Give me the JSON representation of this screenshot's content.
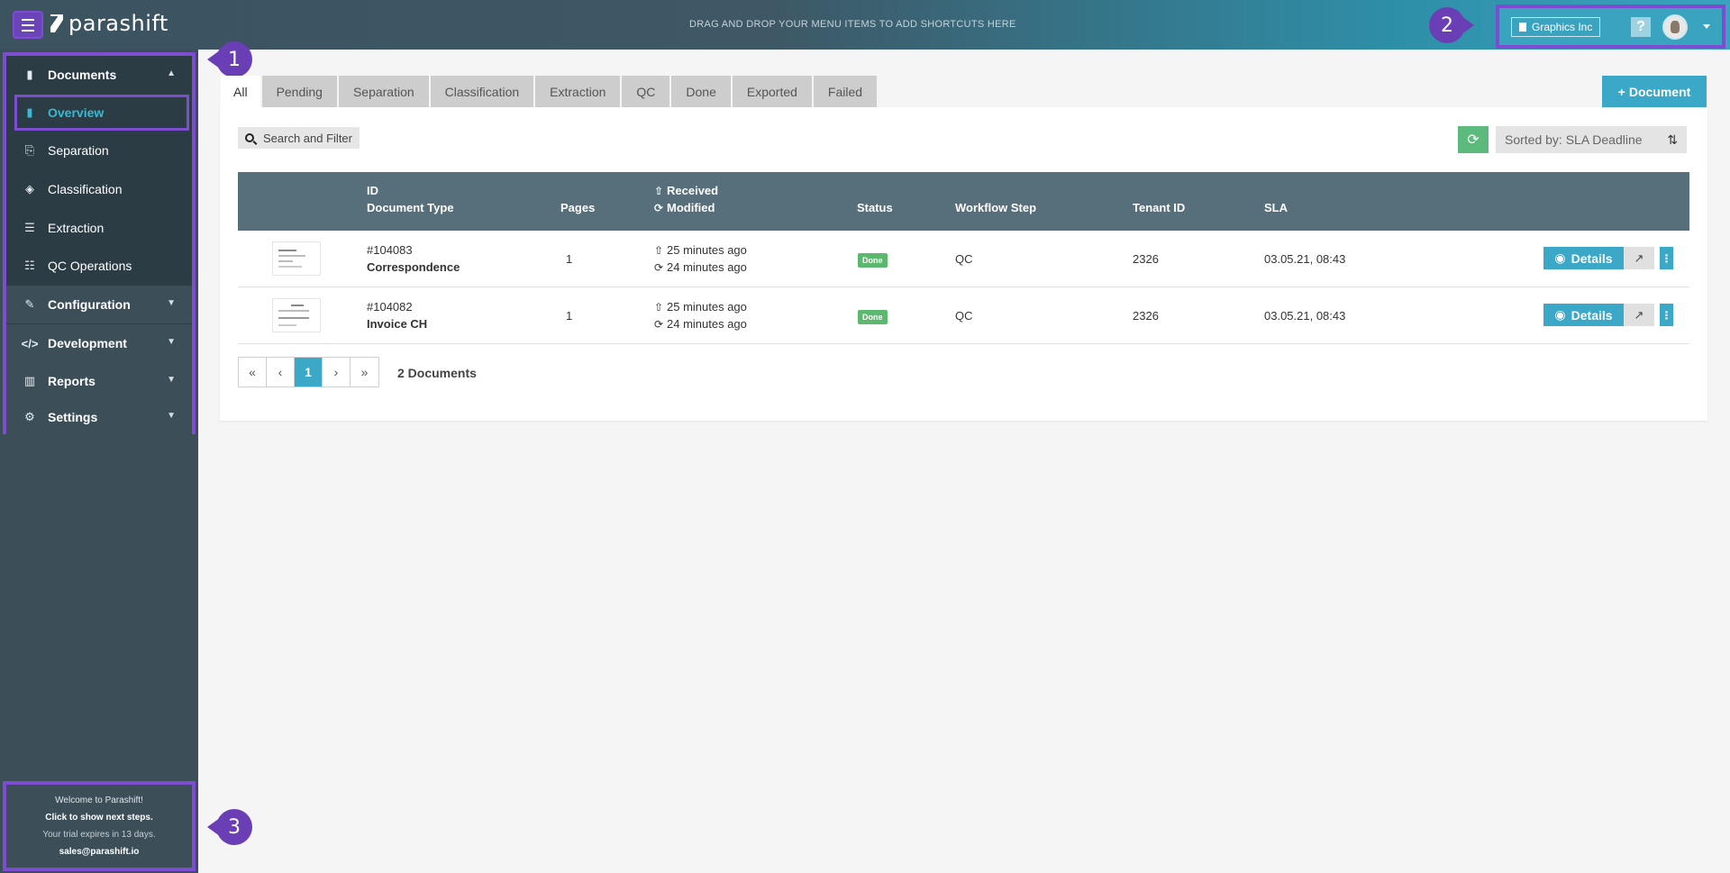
{
  "header": {
    "logo_text": "parashift",
    "shortcut_hint": "DRAG AND DROP YOUR MENU ITEMS TO ADD SHORTCUTS HERE",
    "tenant_label": "Graphics Inc",
    "help_label": "?"
  },
  "callouts": {
    "one": "1",
    "two": "2",
    "three": "3"
  },
  "sidebar": {
    "documents": "Documents",
    "overview": "Overview",
    "separation": "Separation",
    "classification": "Classification",
    "extraction": "Extraction",
    "qc_operations": "QC Operations",
    "configuration": "Configuration",
    "development": "Development",
    "reports": "Reports",
    "settings": "Settings"
  },
  "trial": {
    "welcome": "Welcome to Parashift!",
    "next_steps": "Click to show next steps.",
    "expires": "Your trial expires in 13 days.",
    "email": "sales@parashift.io"
  },
  "tabs": [
    "All",
    "Pending",
    "Separation",
    "Classification",
    "Extraction",
    "QC",
    "Done",
    "Exported",
    "Failed"
  ],
  "toolbar": {
    "add_document": "Document",
    "search_filter": "Search and Filter",
    "sort_label": "Sorted by: SLA Deadline"
  },
  "table": {
    "headers": {
      "id": "ID",
      "document_type": "Document Type",
      "pages": "Pages",
      "received": "Received",
      "modified": "Modified",
      "status": "Status",
      "workflow_step": "Workflow Step",
      "tenant_id": "Tenant ID",
      "sla": "SLA"
    },
    "rows": [
      {
        "id": "#104083",
        "type": "Correspondence",
        "pages": "1",
        "received": "25 minutes ago",
        "modified": "24 minutes ago",
        "status": "Done",
        "step": "QC",
        "tenant": "2326",
        "sla": "03.05.21, 08:43",
        "details": "Details"
      },
      {
        "id": "#104082",
        "type": "Invoice CH",
        "pages": "1",
        "received": "25 minutes ago",
        "modified": "24 minutes ago",
        "status": "Done",
        "step": "QC",
        "tenant": "2326",
        "sla": "03.05.21, 08:43",
        "details": "Details"
      }
    ]
  },
  "pagination": {
    "first": "«",
    "prev": "‹",
    "current": "1",
    "next": "›",
    "last": "»",
    "count": "2 Documents"
  },
  "icons": {
    "menu": "hamburger-icon",
    "document": "document-icon",
    "separation": "split-icon",
    "classification": "tags-icon",
    "extraction": "list-icon",
    "qc": "checklist-icon",
    "configuration": "wrench-icon",
    "development": "code-icon",
    "reports": "bar-chart-icon",
    "settings": "gear-icon",
    "refresh": "refresh-icon",
    "sort": "sort-icon",
    "details": "eye-icon",
    "external": "external-link-icon",
    "more": "vertical-dots-icon"
  },
  "colors": {
    "accent": "#3aa8c6",
    "highlight": "#7d4cd0",
    "sidebar": "#3c4f59",
    "status_done": "#5cb86f",
    "table_header": "#566f7b"
  }
}
